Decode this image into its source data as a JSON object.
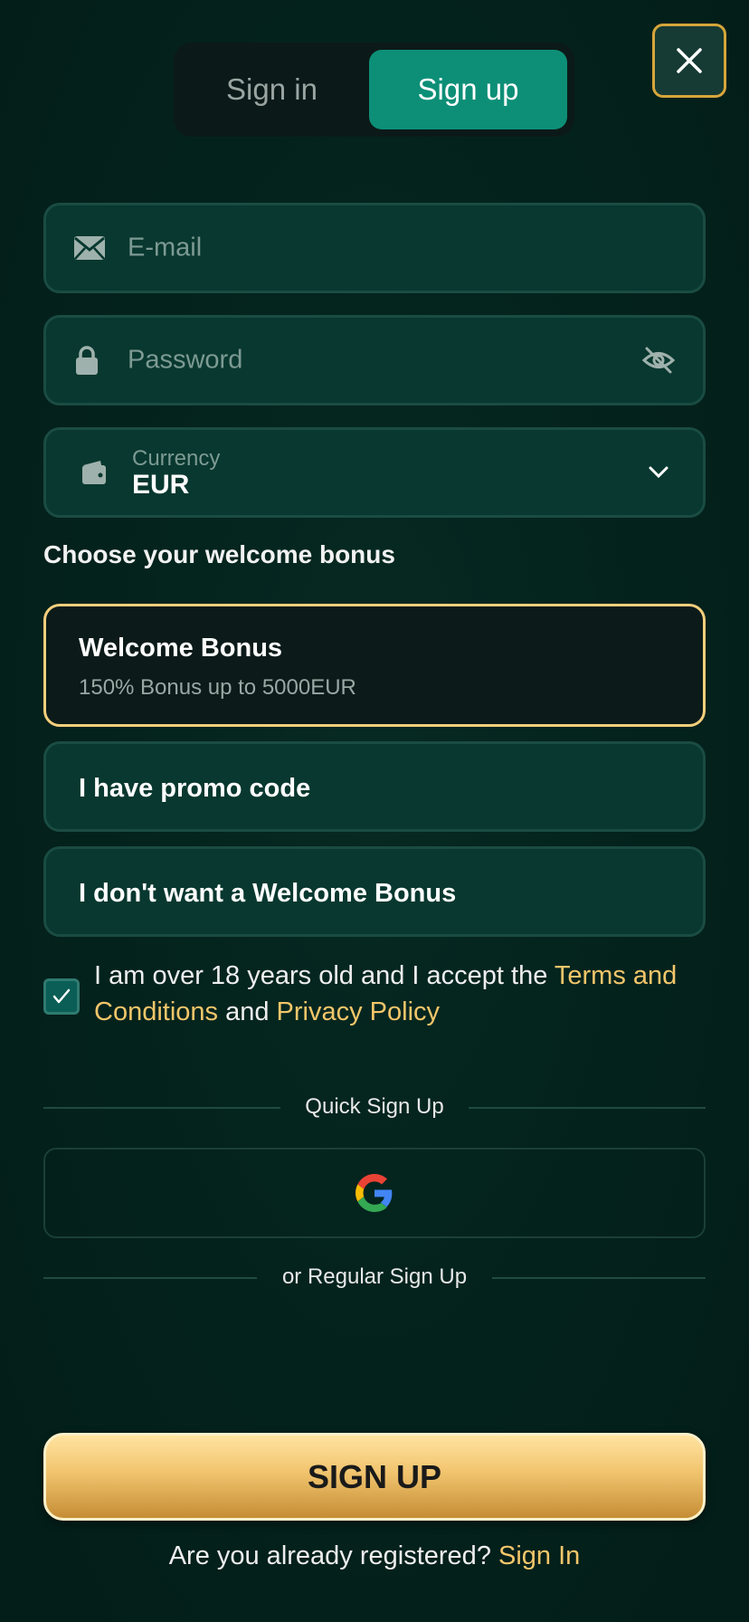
{
  "tabs": {
    "signin": "Sign in",
    "signup": "Sign up"
  },
  "form": {
    "email_placeholder": "E-mail",
    "password_placeholder": "Password",
    "currency_label": "Currency",
    "currency_value": "EUR"
  },
  "bonus": {
    "section_title": "Choose your welcome bonus",
    "options": [
      {
        "title": "Welcome Bonus",
        "subtitle": "150% Bonus up to 5000EUR",
        "selected": true
      },
      {
        "title": "I have promo code"
      },
      {
        "title": "I don't want a Welcome Bonus"
      }
    ]
  },
  "terms": {
    "checked": true,
    "prefix": "I am over 18 years old and I accept the ",
    "terms_link": "Terms and Conditions",
    "middle": " and ",
    "privacy_link": "Privacy Policy"
  },
  "quick_signup_label": "Quick Sign Up",
  "regular_signup_label": "or Regular Sign Up",
  "signup_button": "SIGN UP",
  "footer": {
    "question": "Are you already registered? ",
    "link": "Sign In"
  },
  "colors": {
    "accent_teal": "#0d8f77",
    "gold": "#f3c66a",
    "background": "#04231d"
  },
  "icons": [
    "close-icon",
    "envelope-icon",
    "lock-icon",
    "eye-off-icon",
    "wallet-icon",
    "chevron-down-icon",
    "check-icon",
    "google-icon"
  ]
}
